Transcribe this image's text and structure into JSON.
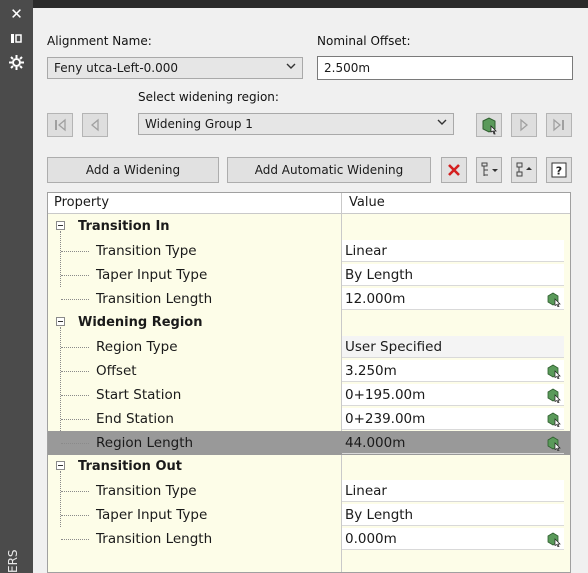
{
  "sidebar": {
    "vertical_text": "ERS"
  },
  "alignment": {
    "label": "Alignment Name:",
    "value": "Feny utca-Left-0.000"
  },
  "offset": {
    "label": "Nominal Offset:",
    "value": "2.500m"
  },
  "region": {
    "label": "Select widening region:",
    "value": "Widening Group 1"
  },
  "buttons": {
    "add_widening": "Add a Widening",
    "add_automatic": "Add Automatic Widening"
  },
  "grid": {
    "col_property": "Property",
    "col_value": "Value",
    "rows": [
      {
        "kind": "cat",
        "name": "Transition In"
      },
      {
        "kind": "prop",
        "name": "Transition Type",
        "value": "Linear",
        "pick": false,
        "ro": false
      },
      {
        "kind": "prop",
        "name": "Taper Input Type",
        "value": "By Length",
        "pick": false,
        "ro": false
      },
      {
        "kind": "prop",
        "name": "Transition Length",
        "value": "12.000m",
        "pick": true,
        "ro": false
      },
      {
        "kind": "cat",
        "name": "Widening Region"
      },
      {
        "kind": "prop",
        "name": "Region Type",
        "value": "User Specified",
        "pick": false,
        "ro": true
      },
      {
        "kind": "prop",
        "name": "Offset",
        "value": "3.250m",
        "pick": true,
        "ro": false
      },
      {
        "kind": "prop",
        "name": "Start Station",
        "value": "0+195.00m",
        "pick": true,
        "ro": false
      },
      {
        "kind": "prop",
        "name": "End Station",
        "value": "0+239.00m",
        "pick": true,
        "ro": false
      },
      {
        "kind": "prop",
        "name": "Region Length",
        "value": "44.000m",
        "pick": true,
        "ro": true,
        "selected": true
      },
      {
        "kind": "cat",
        "name": "Transition Out"
      },
      {
        "kind": "prop",
        "name": "Transition Type",
        "value": "Linear",
        "pick": false,
        "ro": false
      },
      {
        "kind": "prop",
        "name": "Taper Input Type",
        "value": "By Length",
        "pick": false,
        "ro": false
      },
      {
        "kind": "prop",
        "name": "Transition Length",
        "value": "0.000m",
        "pick": true,
        "ro": false
      }
    ]
  },
  "colors": {
    "grid_bg": "#fdfde8",
    "selected_row": "#999999",
    "delete_red": "#d42020",
    "pick_green": "#3a8a3a"
  }
}
